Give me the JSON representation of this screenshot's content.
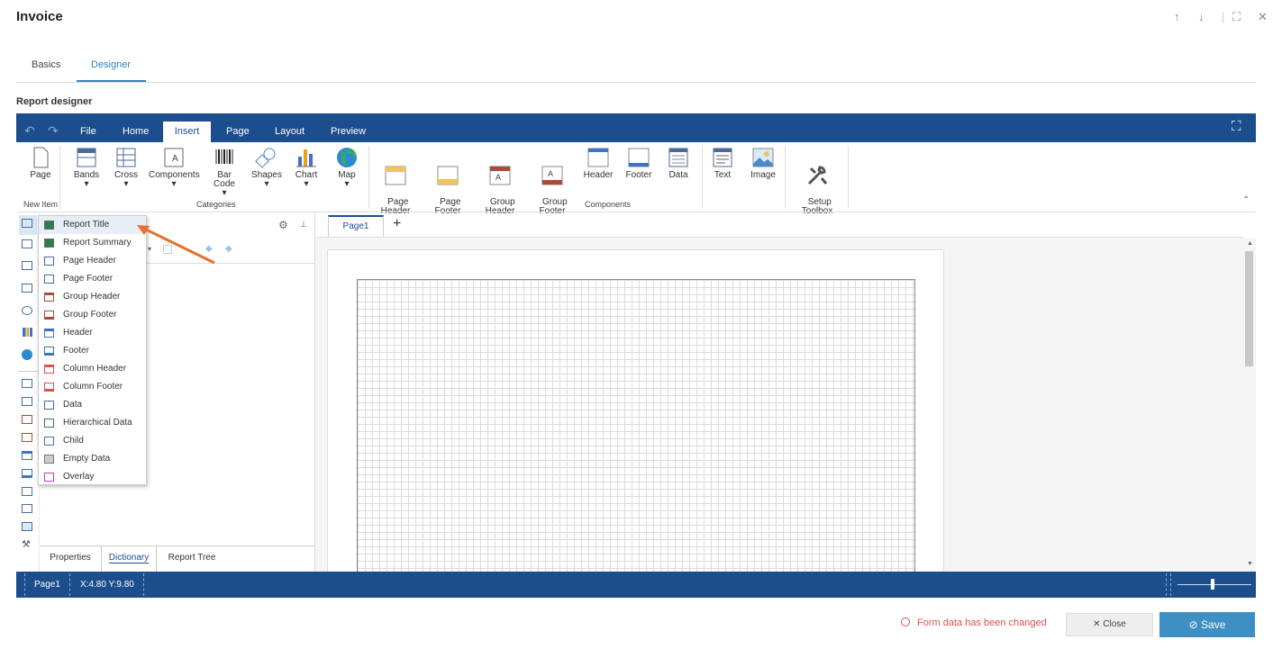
{
  "window": {
    "title": "Invoice",
    "up": "↑",
    "down": "↓",
    "expand": "⛶",
    "close": "✕"
  },
  "tabs": [
    {
      "label": "Basics"
    },
    {
      "label": "Designer"
    }
  ],
  "designer": {
    "title": "Report designer"
  },
  "menubar": {
    "undo": "↶",
    "redo": "↷",
    "tabs": [
      "File",
      "Home",
      "Insert",
      "Page",
      "Layout",
      "Preview"
    ],
    "fullscreen": "⛶"
  },
  "ribbon": {
    "new_item": {
      "button": "Page",
      "group": "New Item"
    },
    "categories": {
      "group": "Categories",
      "buttons": [
        "Bands",
        "Cross",
        "Components",
        "Bar Code",
        "Shapes",
        "Chart",
        "Map"
      ]
    },
    "components": {
      "group": "Components",
      "buttons": [
        "Page\nHeader",
        "Page\nFooter",
        "Group\nHeader",
        "Group\nFooter",
        "Header",
        "Footer",
        "Data"
      ]
    },
    "extra": [
      "Text",
      "Image",
      "Setup\nToolbox"
    ]
  },
  "dropdown": {
    "items": [
      "Report Title",
      "Report Summary",
      "Page Header",
      "Page Footer",
      "Group Header",
      "Group Footer",
      "Header",
      "Footer",
      "Column Header",
      "Column Footer",
      "Data",
      "Hierarchical Data",
      "Child",
      "Empty Data",
      "Overlay"
    ]
  },
  "panel": {
    "bottom_tabs": [
      "Properties",
      "Dictionary",
      "Report Tree"
    ],
    "settings": "⚙",
    "pin": "📌"
  },
  "page_tab": {
    "label": "Page1",
    "add": "+"
  },
  "status": {
    "page": "Page1",
    "coords": "X:4.80 Y:9.80"
  },
  "footer": {
    "changed": "Form data has been changed",
    "close": "✕ Close",
    "save": "⊘ Save"
  },
  "colors": {
    "brand": "#1c4e8e",
    "accent": "#2e82c8",
    "save": "#3d8fc4",
    "warning": "#d9534f"
  }
}
